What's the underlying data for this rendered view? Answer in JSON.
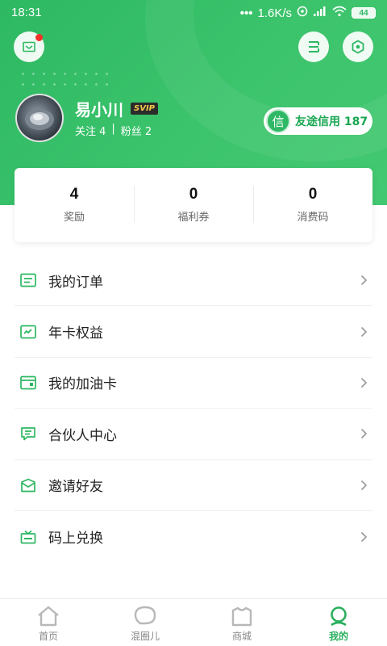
{
  "status_bar": {
    "time": "18:31",
    "network_speed": "1.6K/s",
    "battery": "44"
  },
  "profile": {
    "username": "易小川",
    "vip_badge": "SVIP",
    "following_label": "关注 4",
    "followers_label": "粉丝 2",
    "separator": "|",
    "credit_icon_char": "信",
    "credit_text": "友途信用 187"
  },
  "stats": [
    {
      "value": "4",
      "label": "奖励"
    },
    {
      "value": "0",
      "label": "福利券"
    },
    {
      "value": "0",
      "label": "消费码"
    }
  ],
  "menu": [
    {
      "label": "我的订单",
      "icon": "order-icon"
    },
    {
      "label": "年卡权益",
      "icon": "annual-card-icon"
    },
    {
      "label": "我的加油卡",
      "icon": "fuel-card-icon"
    },
    {
      "label": "合伙人中心",
      "icon": "partner-icon"
    },
    {
      "label": "邀请好友",
      "icon": "invite-icon"
    },
    {
      "label": "码上兑换",
      "icon": "redeem-icon"
    }
  ],
  "tabs": [
    {
      "label": "首页",
      "icon": "home-icon",
      "active": false
    },
    {
      "label": "混圈儿",
      "icon": "community-icon",
      "active": false
    },
    {
      "label": "商城",
      "icon": "mall-icon",
      "active": false
    },
    {
      "label": "我的",
      "icon": "profile-icon",
      "active": true
    }
  ],
  "colors": {
    "brand_green": "#2db862",
    "active_tab": "#2aaf5e",
    "notification_dot": "#f2302b"
  }
}
